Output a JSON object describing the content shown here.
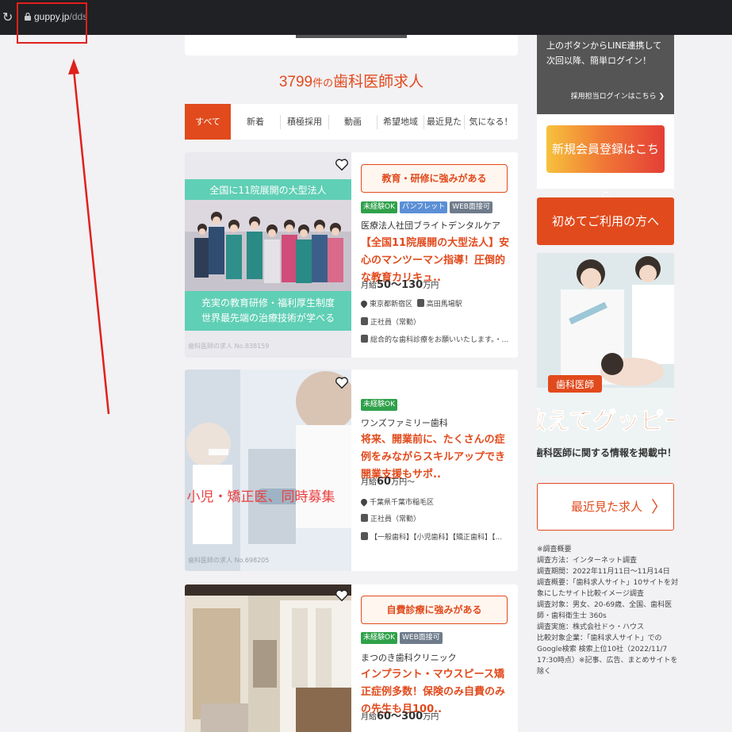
{
  "browser": {
    "url_host": "guppy.jp",
    "url_path": "/dds",
    "reload_icon": "reload-icon",
    "lock_icon": "lock-icon"
  },
  "annotation": {
    "box_color": "#e0201c",
    "arrow_color": "#e0201c"
  },
  "listing": {
    "count": "3799",
    "count_suffix": "件の",
    "title": "歯科医師求人",
    "accent": "#e14a1c"
  },
  "tabs": [
    {
      "label": "すべて",
      "active": true
    },
    {
      "label": "新着"
    },
    {
      "label": "積極採用"
    },
    {
      "label": "動画"
    },
    {
      "label": "希望地域"
    },
    {
      "label": "最近見た"
    },
    {
      "label": "気になる！"
    }
  ],
  "jobs": [
    {
      "image_top": "全国に11院展開の大型法人",
      "image_bottom_1": "充実の教育研修・福利厚生制度",
      "image_bottom_2": "世界最先端の治療技術が学べる",
      "image_caption": "歯科医師の求人 No.838159",
      "feature": "教育・研修に強みがある",
      "badges": [
        "未経験OK",
        "パンフレット",
        "WEB面接可"
      ],
      "clinic": "医療法人社団ブライトデンタルケア",
      "catch": "【全国11院展開の大型法人】安心のマンツーマン指導！圧倒的な教育カリキュ..",
      "salary_prefix": "月給",
      "salary_value": "50～130",
      "salary_unit": "万円",
      "location": "東京都新宿区",
      "station": "高田馬場駅",
      "employment": "正社員（常勤）",
      "note": "総合的な歯科診療をお願いいたします。・..."
    },
    {
      "image_overlay": "小児・矯正医、同時募集",
      "image_caption": "歯科医師の求人 No.698205",
      "badges": [
        "未経験OK"
      ],
      "clinic": "ワンズファミリー歯科",
      "catch": "将来、開業前に、たくさんの症例をみながらスキルアップでき開業支援もサポ..",
      "salary_prefix": "月給",
      "salary_value": "60",
      "salary_unit": "万円～",
      "location": "千葉県千葉市稲毛区",
      "employment": "正社員（常勤）",
      "note": "【一般歯科】【小児歯科】【矯正歯科】【..."
    },
    {
      "feature": "自費診療に強みがある",
      "badges": [
        "未経験OK",
        "WEB面接可"
      ],
      "clinic": "まつのき歯科クリニック",
      "catch": "インプラント・マウスピース矯正症例多数！保険のみ自費のみの先生も月100..",
      "salary_prefix": "月給",
      "salary_value": "60～300",
      "salary_unit": "万円"
    }
  ],
  "sidebar": {
    "login_text": "上のボタンからLINE連携して次回以降、簡単ログイン！",
    "login_link": "採用担当ログインはこちら ❯",
    "register": "新規会員登録はこちら",
    "first_time": "初めてご利用の方へ",
    "banner_tag": "歯科医師",
    "banner_title": "教えてグッピー",
    "banner_sub": "歯科医師に関する情報を掲載中！",
    "recent": "最近見た求人",
    "recent_chevron": "〉",
    "survey_lines": [
      "※調査概要",
      "調査方法：インターネット調査",
      "調査期間：2022年11月11日～11月14日",
      "調査概要：「歯科求人サイト」10サイトを対象にしたサイト比較イメージ調査",
      "調査対象：男女、20-69歳、全国、歯科医師・歯科衛生士 360s",
      "調査実施：株式会社ドゥ・ハウス",
      "比較対象企業：「歯科求人サイト」でのGoogle検索 検索上位10社（2022/11/7 17:30時点）※記事、広告、まとめサイトを除く"
    ]
  }
}
